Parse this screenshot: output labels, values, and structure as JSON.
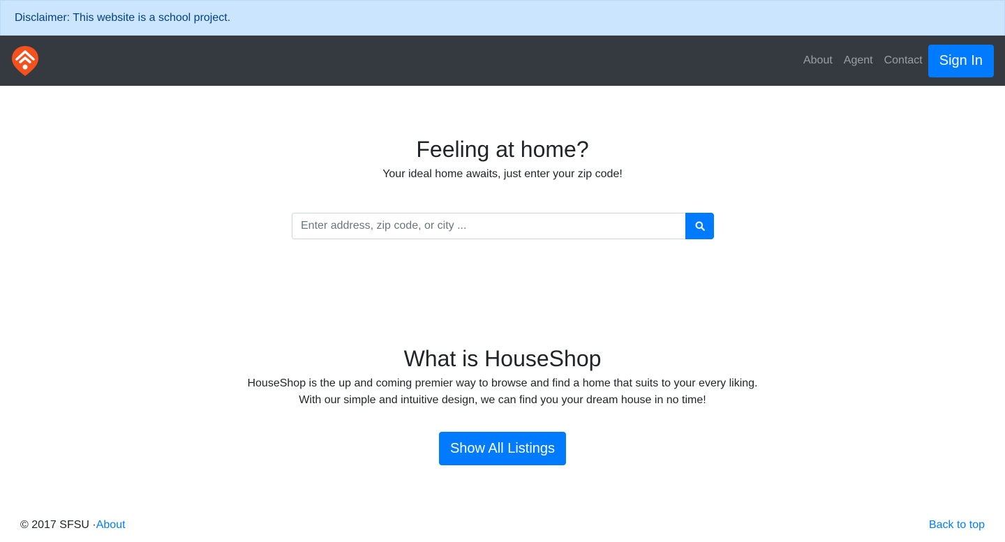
{
  "disclaimer": {
    "text": "Disclaimer: This website is a school project."
  },
  "navbar": {
    "logo_icon": "houseshop-logo-icon",
    "links": [
      {
        "label": "About"
      },
      {
        "label": "Agent"
      },
      {
        "label": "Contact"
      }
    ],
    "signin_label": "Sign In"
  },
  "hero": {
    "title": "Feeling at home?",
    "subtitle": "Your ideal home awaits, just enter your zip code!"
  },
  "search": {
    "placeholder": "Enter address, zip code, or city ...",
    "value": "",
    "button_icon": "search-icon"
  },
  "about": {
    "title": "What is HouseShop",
    "line1": "HouseShop is the up and coming premier way to browse and find a home that suits to your every liking.",
    "line2": "With our simple and intuitive design, we can find you your dream house in no time!",
    "button_label": "Show All Listings"
  },
  "footer": {
    "copyright": "© 2017 SFSU · ",
    "about_link": "About",
    "back_to_top": "Back to top"
  },
  "colors": {
    "primary": "#007bff",
    "navbar_bg": "#343a40",
    "disclaimer_bg": "#cce5ff",
    "disclaimer_text": "#004085",
    "logo": "#f4511e"
  }
}
